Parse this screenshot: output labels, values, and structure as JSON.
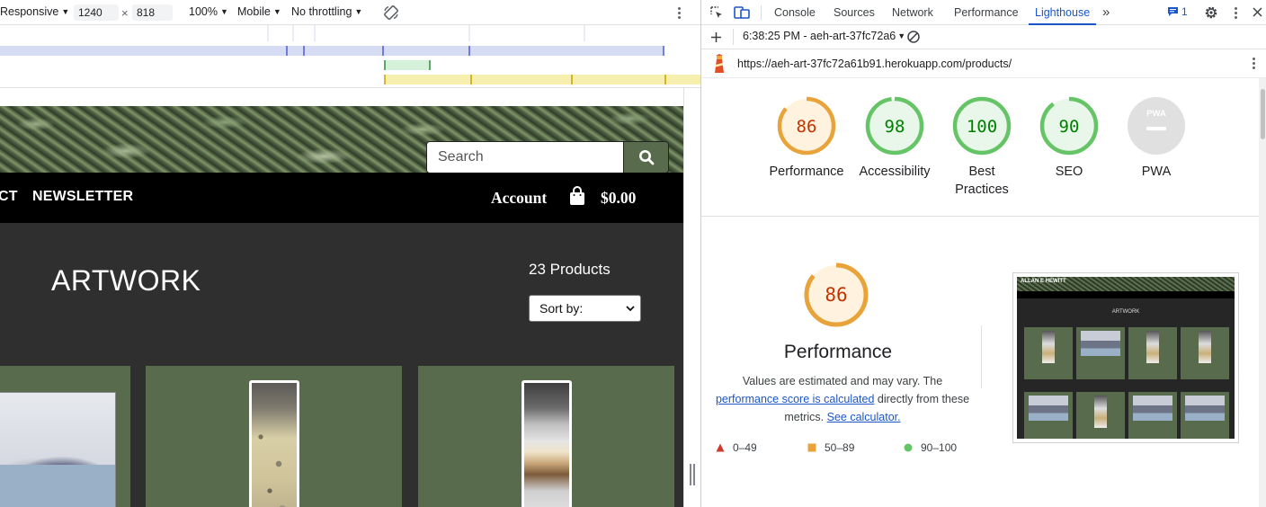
{
  "device_toolbar": {
    "device": "Responsive",
    "width": "1240",
    "times": "×",
    "height": "818",
    "zoom": "100%",
    "device_type": "Mobile",
    "throttling": "No throttling"
  },
  "site": {
    "search": {
      "placeholder": "Search"
    },
    "nav": {
      "partial_link": "CT",
      "newsletter": "NEWSLETTER",
      "account": "Account",
      "cart_total": "$0.00"
    },
    "page_title": "ARTWORK",
    "product_count": "23 Products",
    "sort_label": "Sort by:"
  },
  "devtools": {
    "tabs": [
      "Console",
      "Sources",
      "Network",
      "Performance",
      "Lighthouse"
    ],
    "active_tab": "Lighthouse",
    "issues_count": "1",
    "report_selector": "6:38:25 PM - aeh-art-37fc72a6",
    "url": "https://aeh-art-37fc72a61b91.herokuapp.com/products/"
  },
  "lighthouse": {
    "scores": [
      {
        "label": "Performance",
        "score": "86",
        "color": "#e8a33a",
        "text_color": "#c33300"
      },
      {
        "label": "Accessibility",
        "score": "98",
        "color": "#65c466",
        "text_color": "#008000"
      },
      {
        "label": "Best Practices",
        "score": "100",
        "color": "#65c466",
        "text_color": "#008000"
      },
      {
        "label": "SEO",
        "score": "90",
        "color": "#65c466",
        "text_color": "#008000"
      },
      {
        "label": "PWA",
        "score": "PWA",
        "color": "#e0e0e0",
        "text_color": "#a8a8a8"
      }
    ],
    "performance": {
      "score": "86",
      "title": "Performance",
      "desc_1": "Values are estimated and may vary. The",
      "desc_link_1": "performance score is calculated",
      "desc_2": " directly from these",
      "desc_3": "metrics. ",
      "desc_link_2": "See calculator."
    },
    "legend": [
      {
        "range": "0–49",
        "color": "#cc3b2b"
      },
      {
        "range": "50–89",
        "color": "#e8a33a"
      },
      {
        "range": "90–100",
        "color": "#65c466"
      }
    ],
    "screenshot": {
      "site_name": "ALLAN E HEWITT",
      "title": "ARTWORK"
    }
  }
}
